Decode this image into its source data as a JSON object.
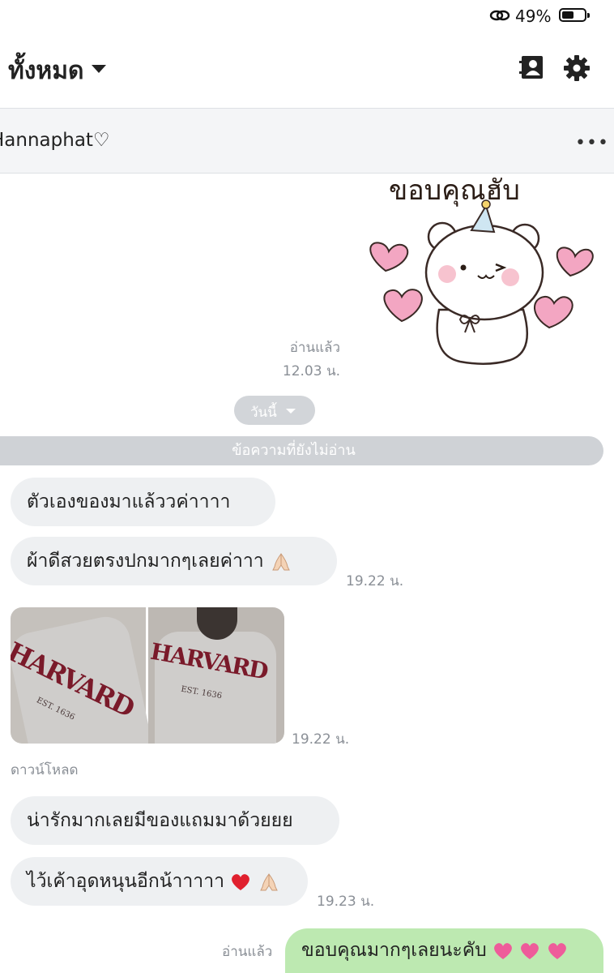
{
  "status": {
    "battery": "49%"
  },
  "header": {
    "title": "ทั้งหมด"
  },
  "chat": {
    "name": "Hannaphat♡",
    "more": "•••"
  },
  "sticker": {
    "caption": "ขอบคุณฮับ"
  },
  "sent_read_1": {
    "read": "อ่านแล้ว",
    "time": "12.03 น."
  },
  "date_divider": "วันนี้",
  "unread_divider": "ข้อความที่ยังไม่อ่าน",
  "messages": [
    {
      "text": "ตัวเองของมาแล้ววค่าาาา"
    },
    {
      "text": "ผ้าดีสวยตรงปกมากๆเลยค่าาา",
      "time": "19.22 น."
    },
    {
      "photo_text_1": "HARVARD",
      "photo_sub": "EST. 1636",
      "time": "19.22 น.",
      "download": "ดาวน์โหลด"
    },
    {
      "text": "น่ารักมากเลยมีของแถมมาด้วยยย"
    },
    {
      "text": "ไว้เค้าอุดหนุนอีกน้าาาาา",
      "time": "19.23 น."
    }
  ],
  "outgoing": {
    "read": "อ่านแล้ว",
    "text": "ขอบคุณมากๆเลยนะคับ"
  },
  "colors": {
    "incoming_bubble": "#eef0f2",
    "outgoing_bubble": "#bde9b1",
    "divider": "#cfd2d6"
  },
  "icons": [
    "link-icon",
    "battery-icon",
    "caret-down-icon",
    "contacts-icon",
    "gear-icon",
    "more-icon",
    "pray-emoji",
    "heart-emoji",
    "pink-heart-emoji"
  ]
}
